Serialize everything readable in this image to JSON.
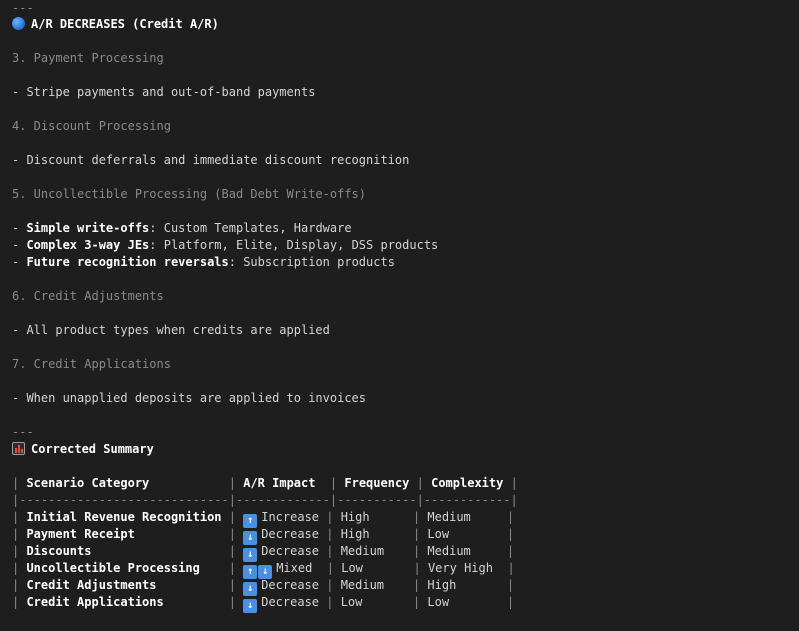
{
  "rule_top": "---",
  "section_ar_decreases": "A/R DECREASES (Credit A/R)",
  "headings": [
    "3. Payment Processing",
    "4. Discount Processing",
    "5. Uncollectible Processing (Bad Debt Write-offs)",
    "6. Credit Adjustments",
    "7. Credit Applications"
  ],
  "payment_bullet": "- Stripe payments and out-of-band payments",
  "discount_bullet": "- Discount deferrals and immediate discount recognition",
  "uncollectible_bullets": [
    {
      "prefix": "- ",
      "term": "Simple write-offs",
      "rest": ": Custom Templates, Hardware"
    },
    {
      "prefix": "- ",
      "term": "Complex 3-way JEs",
      "rest": ": Platform, Elite, Display, DSS products"
    },
    {
      "prefix": "- ",
      "term": "Future recognition reversals",
      "rest": ": Subscription products"
    }
  ],
  "credit_adj_bullet": "- All product types when credits are applied",
  "credit_app_bullet": "- When unapplied deposits are applied to invoices",
  "rule_mid": "---",
  "summary_title": "Corrected Summary",
  "table": {
    "header": [
      "Scenario Category",
      "A/R Impact",
      "Frequency",
      "Complexity"
    ],
    "separator": "|-----------------------------|-------------|-----------|------------|",
    "rows": [
      {
        "category": "Initial Revenue Recognition",
        "impact_icon": "up",
        "impact": "Increase",
        "frequency": "High",
        "complexity": "Medium"
      },
      {
        "category": "Payment Receipt",
        "impact_icon": "down",
        "impact": "Decrease",
        "frequency": "High",
        "complexity": "Low"
      },
      {
        "category": "Discounts",
        "impact_icon": "down",
        "impact": "Decrease",
        "frequency": "Medium",
        "complexity": "Medium"
      },
      {
        "category": "Uncollectible Processing",
        "impact_icon": "updown",
        "impact": "Mixed",
        "frequency": "Low",
        "complexity": "Very High"
      },
      {
        "category": "Credit Adjustments",
        "impact_icon": "down",
        "impact": "Decrease",
        "frequency": "Medium",
        "complexity": "High"
      },
      {
        "category": "Credit Applications",
        "impact_icon": "down",
        "impact": "Decrease",
        "frequency": "Low",
        "complexity": "Low"
      }
    ]
  },
  "colors": {
    "background": "#1e1e1e",
    "text": "#d4d4d4",
    "dim": "#8a8a8a",
    "accent_blue": "#4a90e2"
  },
  "icons": {
    "section": "blue-circle-icon",
    "summary": "bar-chart-icon",
    "up": "up-arrow-icon",
    "down": "down-arrow-icon"
  }
}
